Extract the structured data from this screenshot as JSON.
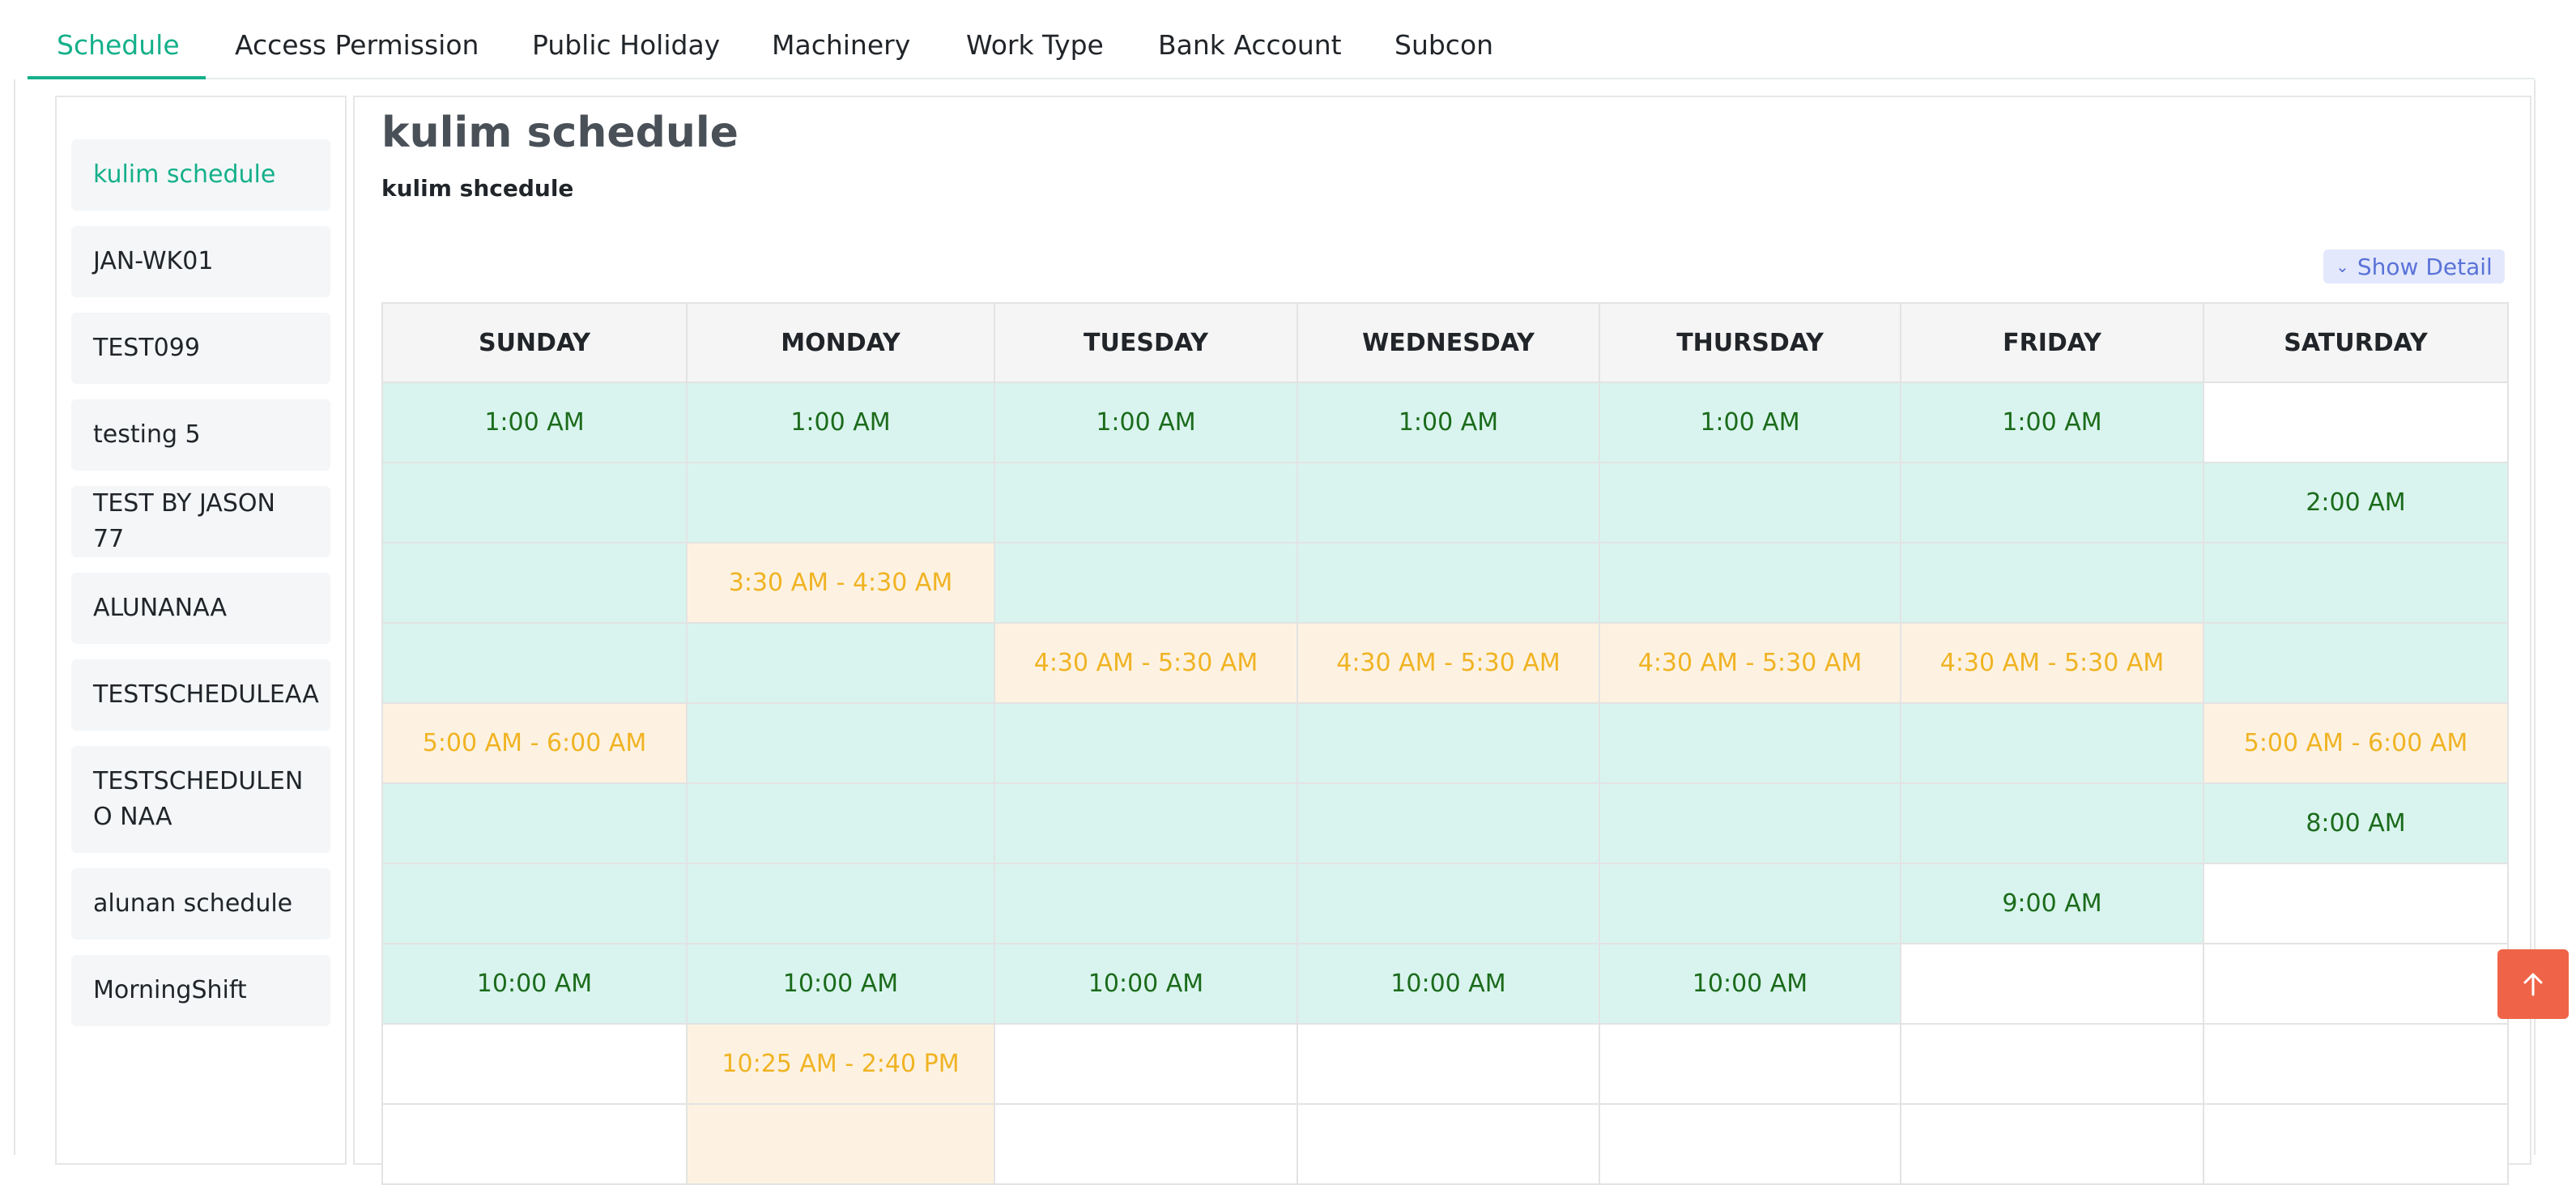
{
  "tabs": [
    "Schedule",
    "Access Permission",
    "Public Holiday",
    "Machinery",
    "Work Type",
    "Bank Account",
    "Subcon"
  ],
  "sidebar": {
    "items": [
      "kulim schedule",
      "JAN-WK01",
      "TEST099",
      "testing 5",
      "TEST BY JASON 77",
      "ALUNANAA",
      "TESTSCHEDULEAA",
      "TESTSCHEDULENO NAA",
      "alunan schedule",
      "MorningShift"
    ],
    "active": "kulim schedule"
  },
  "schedule": {
    "title": "kulim schedule",
    "subtitle": "kulim shcedule",
    "show_detail_label": "Show Detail",
    "days": [
      "SUNDAY",
      "MONDAY",
      "TUESDAY",
      "WEDNESDAY",
      "THURSDAY",
      "FRIDAY",
      "SATURDAY"
    ],
    "rows": [
      [
        [
          "g",
          "1:00 AM"
        ],
        [
          "g",
          "1:00 AM"
        ],
        [
          "g",
          "1:00 AM"
        ],
        [
          "g",
          "1:00 AM"
        ],
        [
          "g",
          "1:00 AM"
        ],
        [
          "g",
          "1:00 AM"
        ],
        [
          "w",
          ""
        ]
      ],
      [
        [
          "g",
          ""
        ],
        [
          "g",
          ""
        ],
        [
          "g",
          ""
        ],
        [
          "g",
          ""
        ],
        [
          "g",
          ""
        ],
        [
          "g",
          ""
        ],
        [
          "g",
          "2:00 AM"
        ]
      ],
      [
        [
          "g",
          ""
        ],
        [
          "o",
          "3:30 AM - 4:30 AM"
        ],
        [
          "g",
          ""
        ],
        [
          "g",
          ""
        ],
        [
          "g",
          ""
        ],
        [
          "g",
          ""
        ],
        [
          "g",
          ""
        ]
      ],
      [
        [
          "g",
          ""
        ],
        [
          "g",
          ""
        ],
        [
          "o",
          "4:30 AM - 5:30 AM"
        ],
        [
          "o",
          "4:30 AM - 5:30 AM"
        ],
        [
          "o",
          "4:30 AM - 5:30 AM"
        ],
        [
          "o",
          "4:30 AM - 5:30 AM"
        ],
        [
          "g",
          ""
        ]
      ],
      [
        [
          "o",
          "5:00 AM - 6:00 AM"
        ],
        [
          "g",
          ""
        ],
        [
          "g",
          ""
        ],
        [
          "g",
          ""
        ],
        [
          "g",
          ""
        ],
        [
          "g",
          ""
        ],
        [
          "o",
          "5:00 AM - 6:00 AM"
        ]
      ],
      [
        [
          "g",
          ""
        ],
        [
          "g",
          ""
        ],
        [
          "g",
          ""
        ],
        [
          "g",
          ""
        ],
        [
          "g",
          ""
        ],
        [
          "g",
          ""
        ],
        [
          "g",
          "8:00 AM"
        ]
      ],
      [
        [
          "g",
          ""
        ],
        [
          "g",
          ""
        ],
        [
          "g",
          ""
        ],
        [
          "g",
          ""
        ],
        [
          "g",
          ""
        ],
        [
          "g",
          "9:00 AM"
        ],
        [
          "w",
          ""
        ]
      ],
      [
        [
          "g",
          "10:00 AM"
        ],
        [
          "g",
          "10:00 AM"
        ],
        [
          "g",
          "10:00 AM"
        ],
        [
          "g",
          "10:00 AM"
        ],
        [
          "g",
          "10:00 AM"
        ],
        [
          "w",
          ""
        ],
        [
          "w",
          ""
        ]
      ],
      [
        [
          "w",
          ""
        ],
        [
          "o",
          "10:25 AM - 2:40 PM"
        ],
        [
          "w",
          ""
        ],
        [
          "w",
          ""
        ],
        [
          "w",
          ""
        ],
        [
          "w",
          ""
        ],
        [
          "w",
          ""
        ]
      ],
      [
        [
          "w",
          ""
        ],
        [
          "o",
          ""
        ],
        [
          "w",
          ""
        ],
        [
          "w",
          ""
        ],
        [
          "w",
          ""
        ],
        [
          "w",
          ""
        ],
        [
          "w",
          ""
        ]
      ]
    ]
  },
  "colors": {
    "accent": "#15b08a",
    "available_bg": "#d9f4ee",
    "available_text": "#1b6b1b",
    "range_bg": "#fdf2e1",
    "range_text": "#f0b323",
    "scroll_top_bg": "#ef6448"
  },
  "scroll_top_icon": "arrow-up-icon"
}
